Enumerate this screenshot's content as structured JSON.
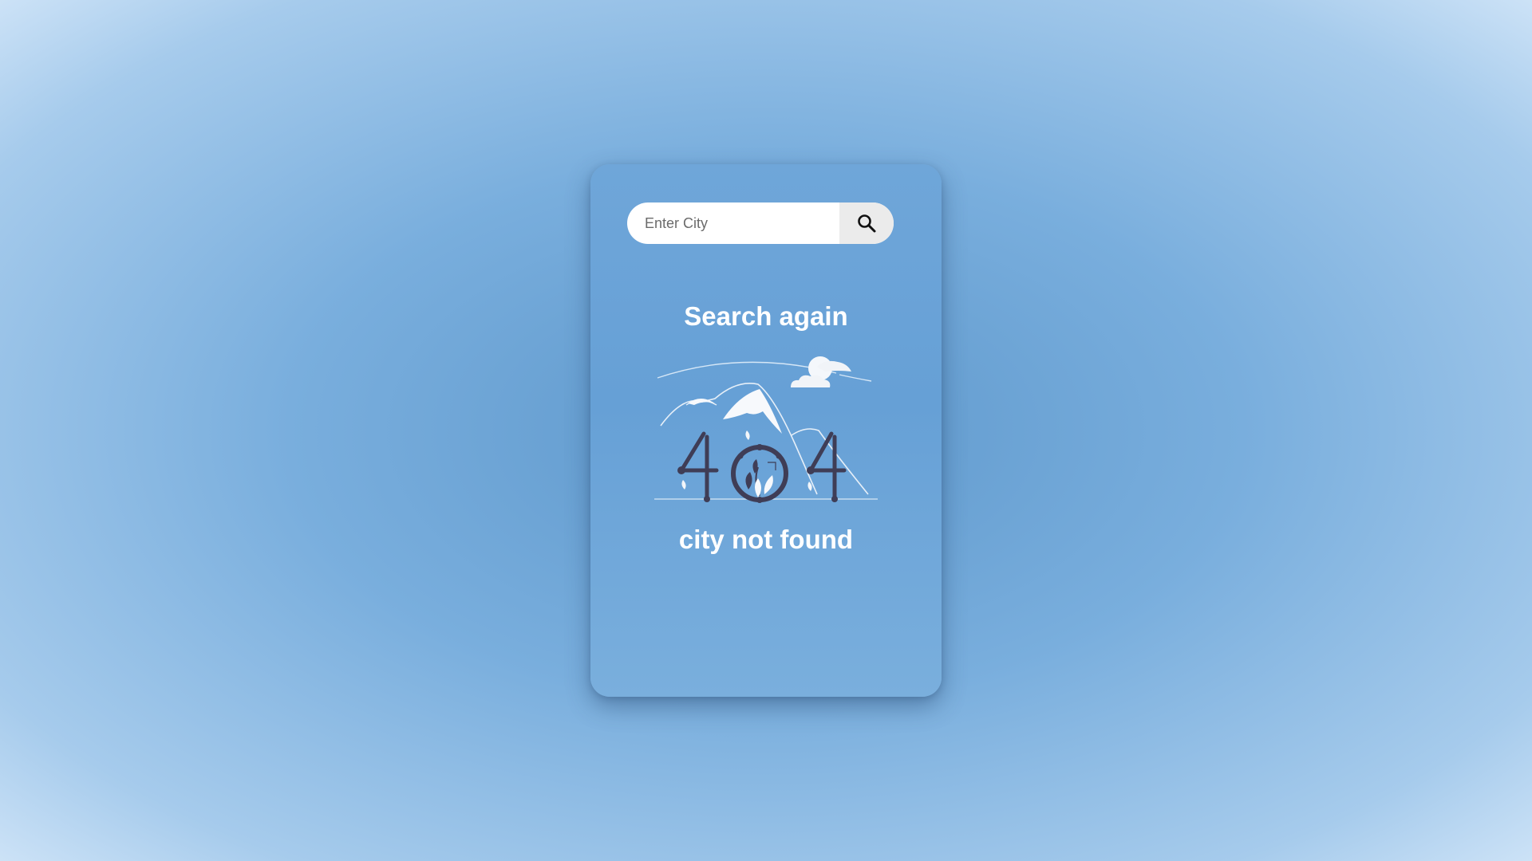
{
  "search": {
    "placeholder": "Enter City",
    "value": "",
    "button_icon": "search-icon"
  },
  "status": {
    "heading": "Search again",
    "message": "city not found",
    "illustration": "404-illustration"
  },
  "colors": {
    "card_bg": "#6ea5d8",
    "text": "#ffffff",
    "search_button_bg": "#ebebeb",
    "illustration_ink": "#3f3d56"
  }
}
